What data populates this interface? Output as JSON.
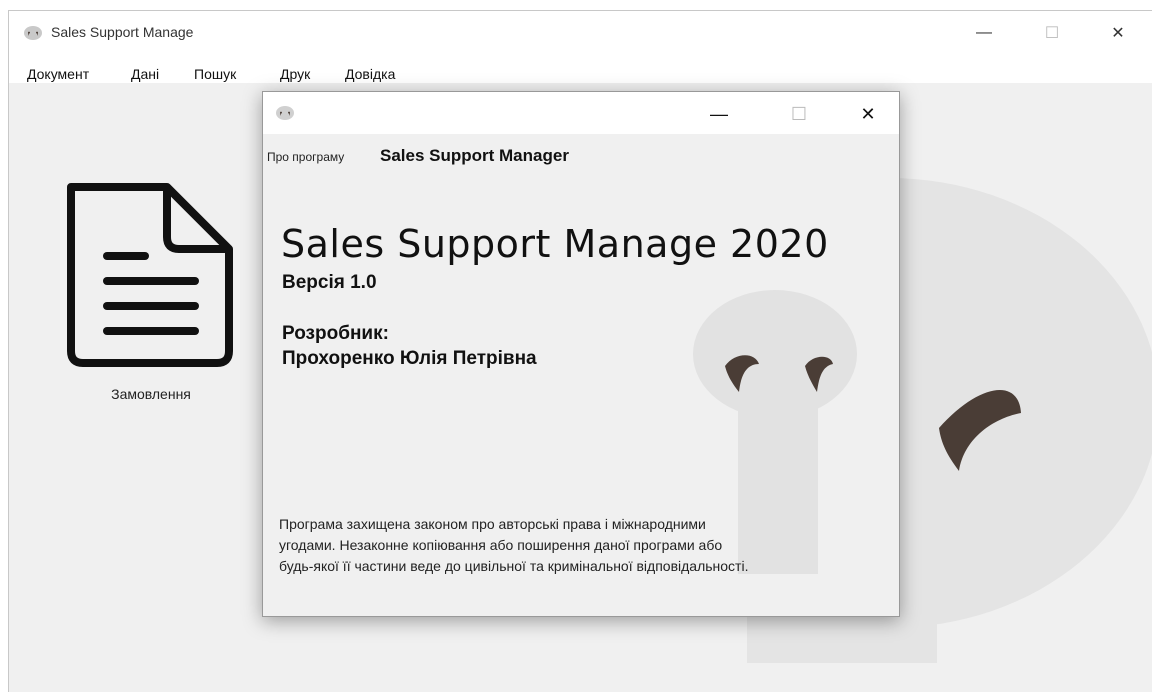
{
  "window": {
    "title": "Sales Support Manage",
    "minimize_glyph": "—",
    "maximize_glyph": "☐",
    "close_glyph": "✕"
  },
  "menu": [
    "Документ",
    "Дані",
    "Пошук",
    "Друк",
    "Довідка"
  ],
  "desktop": {
    "tile_label": "Замовлення",
    "tile_icon": "document-icon"
  },
  "dialog": {
    "minimize_glyph": "—",
    "maximize_glyph": "☐",
    "close_glyph": "✕",
    "about_prefix": "Про програму",
    "about_app": "Sales Support Manager",
    "product_title": "Sales Support Manage 2020",
    "version": "Версія 1.0",
    "developer_label": "Розробник:",
    "developer_name": "Прохоренко Юлія Петрівна",
    "legal_lines": [
      "Програма захищена законом про авторські права і міжнародними",
      "угодами. Незаконне копіювання або поширення даної програми або",
      "будь-якої її частини веде до цивільної та кримінальної відповідальності."
    ]
  },
  "colors": {
    "logo_dark": "#4a3d36",
    "logo_light": "#e2e2e2",
    "window_bg": "#f0f0f0"
  }
}
